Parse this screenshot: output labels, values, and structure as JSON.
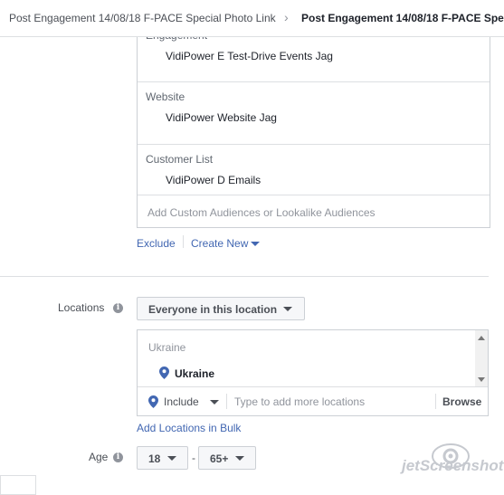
{
  "breadcrumb": {
    "campaign": "Post Engagement 14/08/18 F-PACE Special Photo Link",
    "adset": "Post Engagement 14/08/18 F-PACE Spe"
  },
  "custom_audiences": {
    "groups": [
      {
        "category": "Engagement",
        "item": "VidiPower E Test-Drive Events Jag"
      },
      {
        "category": "Website",
        "item": "VidiPower Website Jag"
      },
      {
        "category": "Customer List",
        "item": "VidiPower D Emails"
      }
    ],
    "input_placeholder": "Add Custom Audiences or Lookalike Audiences",
    "exclude_label": "Exclude",
    "create_new_label": "Create New"
  },
  "locations": {
    "label": "Locations",
    "dropdown_value": "Everyone in this location",
    "country": "Ukraine",
    "selected": "Ukraine",
    "include_label": "Include",
    "search_placeholder": "Type to add more locations",
    "browse_label": "Browse",
    "bulk_link": "Add Locations in Bulk"
  },
  "age": {
    "label": "Age",
    "min": "18",
    "max": "65+",
    "separator": "-"
  },
  "watermark": "jetScreenshot",
  "colors": {
    "link": "#4267b2",
    "border": "#ccd0d5",
    "text": "#1d2129",
    "muted": "#90949c",
    "pin": "#4267b2"
  }
}
